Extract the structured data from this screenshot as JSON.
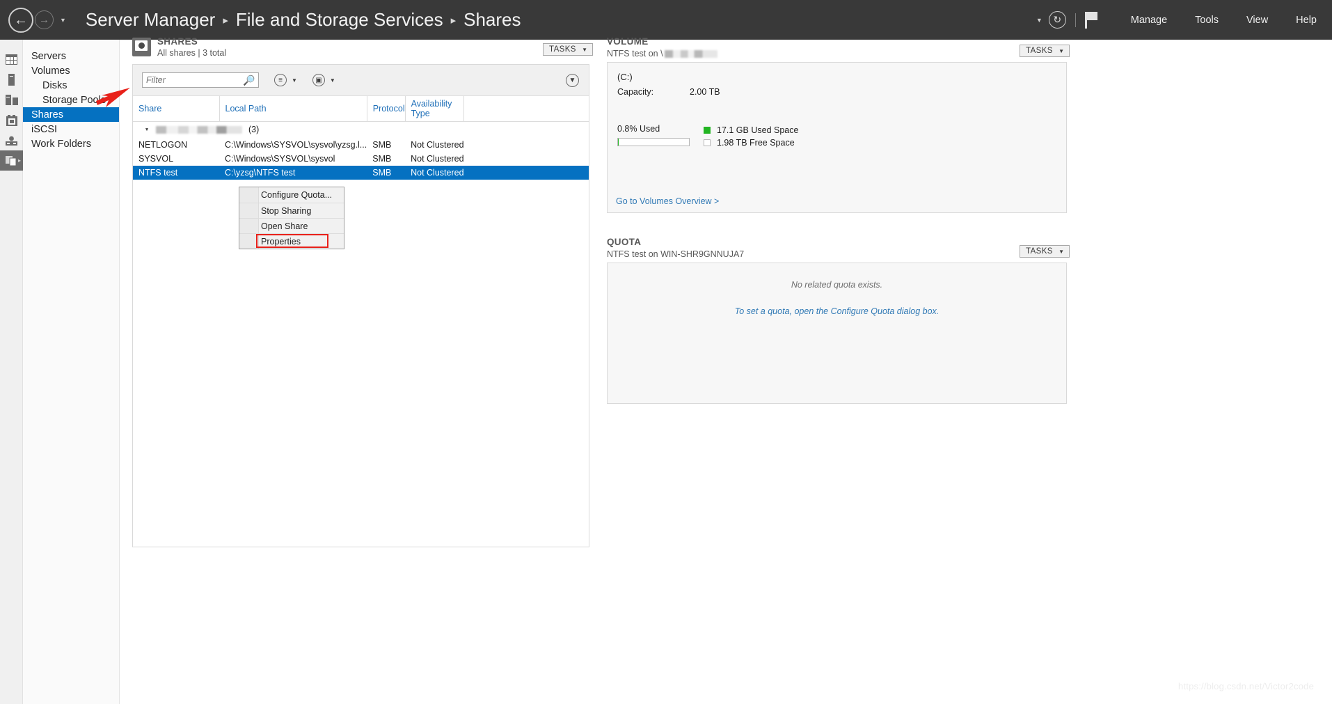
{
  "titlebar": {
    "back_icon": "back-arrow-icon",
    "forward_icon": "forward-arrow-icon",
    "dropdown_icon": "chevron-down-icon",
    "breadcrumb": [
      "Server Manager",
      "File and Storage Services",
      "Shares"
    ],
    "separator": "▸",
    "refresh_icon": "refresh-icon",
    "flag_icon": "notifications-flag-icon",
    "menus": [
      "Manage",
      "Tools",
      "View",
      "Help"
    ]
  },
  "iconrail": {
    "items": [
      {
        "name": "dashboard-icon"
      },
      {
        "name": "local-server-icon"
      },
      {
        "name": "all-servers-icon"
      },
      {
        "name": "file-services-icon"
      },
      {
        "name": "printers-icon"
      },
      {
        "name": "storage-icon",
        "active": true,
        "expand": "▷"
      }
    ]
  },
  "nav": {
    "items": [
      {
        "label": "Servers",
        "indent": false,
        "selected": false
      },
      {
        "label": "Volumes",
        "indent": false,
        "selected": false
      },
      {
        "label": "Disks",
        "indent": true,
        "selected": false
      },
      {
        "label": "Storage Pools",
        "indent": true,
        "selected": false
      },
      {
        "label": "Shares",
        "indent": false,
        "selected": true
      },
      {
        "label": "iSCSI",
        "indent": false,
        "selected": false
      },
      {
        "label": "Work Folders",
        "indent": false,
        "selected": false
      }
    ],
    "highlight_color": "#0571c1",
    "arrow_color": "#e8211a"
  },
  "shares": {
    "icon": "shares-folder-icon",
    "title": "SHARES",
    "subtitle": "All shares | 3 total",
    "tasks_label": "TASKS",
    "tasks_caret": "▼",
    "filter_placeholder": "Filter",
    "filter_value": "",
    "search_icon": "search-icon",
    "list_view_icon": "list-view-icon",
    "save_view_icon": "save-view-icon",
    "caret_icon": "chevron-down-icon",
    "collapse_icon": "chevron-down-circle-icon",
    "columns": [
      "Share",
      "Local Path",
      "Protocol",
      "Availability Type"
    ],
    "group_row": {
      "expander": "▴",
      "label_redacted": true,
      "count": "(3)"
    },
    "rows": [
      {
        "share": "NETLOGON",
        "path": "C:\\Windows\\SYSVOL\\sysvol\\yzsg.l...",
        "protocol": "SMB",
        "availability": "Not Clustered",
        "selected": false
      },
      {
        "share": "SYSVOL",
        "path": "C:\\Windows\\SYSVOL\\sysvol",
        "protocol": "SMB",
        "availability": "Not Clustered",
        "selected": false
      },
      {
        "share": "NTFS test",
        "path": "C:\\yzsg\\NTFS test",
        "protocol": "SMB",
        "availability": "Not Clustered",
        "selected": true
      }
    ]
  },
  "context_menu": {
    "items": [
      "Configure Quota...",
      "Stop Sharing",
      "Open Share",
      "Properties"
    ],
    "highlighted_item": "Properties",
    "highlight_color": "#e8211a"
  },
  "volume": {
    "title": "VOLUME",
    "subtitle_prefix": "NTFS test on \\",
    "subtitle_redacted": true,
    "tasks_label": "TASKS",
    "tasks_caret": "▼",
    "drive_name": "(C:)",
    "capacity_label": "Capacity:",
    "capacity_value": "2.00 TB",
    "used_percent_label": "0.8% Used",
    "used_percent": 0.8,
    "legend": [
      {
        "label": "17.1 GB Used Space",
        "color": "#22b522",
        "filled": true
      },
      {
        "label": "1.98 TB Free Space",
        "color": "#ffffff",
        "filled": false
      }
    ],
    "link": "Go to Volumes Overview >"
  },
  "quota": {
    "title": "QUOTA",
    "subtitle": "NTFS test on WIN-SHR9GNNUJA7",
    "tasks_label": "TASKS",
    "tasks_caret": "▼",
    "empty_message": "No related quota exists.",
    "action_message": "To set a quota, open the Configure Quota dialog box."
  },
  "watermark": "https://blog.csdn.net/Victor2code"
}
